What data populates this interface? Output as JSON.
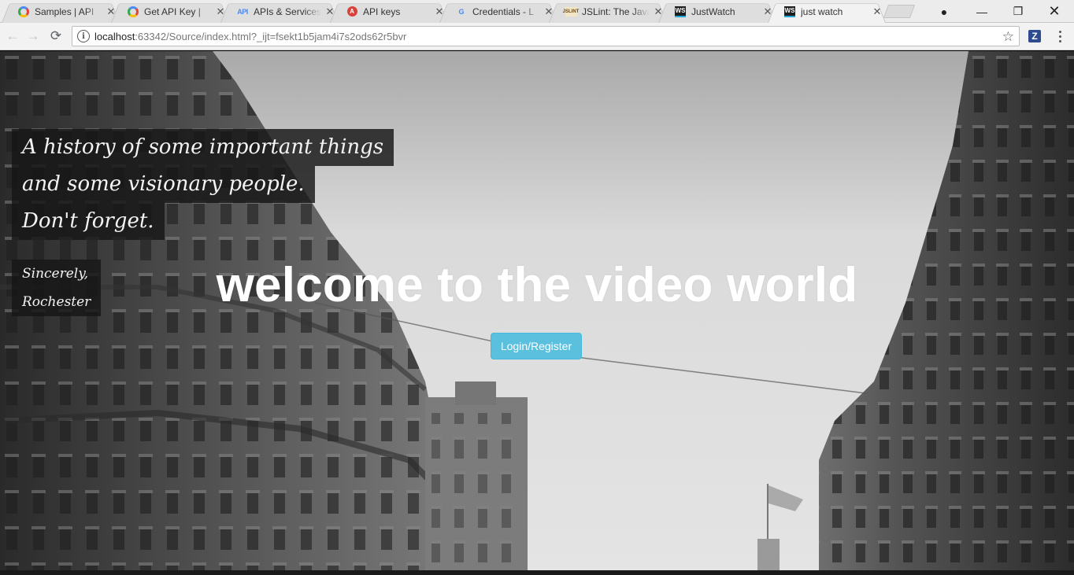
{
  "browser": {
    "tabs": [
      {
        "title": "Samples | API",
        "favicon": "google-dots-icon",
        "active": false
      },
      {
        "title": "Get API Key |",
        "favicon": "google-dots-icon",
        "active": false
      },
      {
        "title": "APIs & Services",
        "favicon": "api-icon",
        "active": false
      },
      {
        "title": "API keys",
        "favicon": "api-keys-icon",
        "active": false
      },
      {
        "title": "Credentials - L",
        "favicon": "google-g-icon",
        "active": false
      },
      {
        "title": "JSLint: The Java",
        "favicon": "jslint-icon",
        "active": false
      },
      {
        "title": "JustWatch",
        "favicon": "webstorm-icon",
        "active": false
      },
      {
        "title": "just watch",
        "favicon": "webstorm-icon",
        "active": true
      }
    ],
    "favicon_text": {
      "api": "API",
      "api_keys": "A",
      "google_g": "G",
      "jslint": "JSLINT",
      "ws": "WS"
    },
    "tab_close": "✕",
    "window_controls": {
      "profile": "●",
      "minimize": "—",
      "restore": "❐",
      "close": "✕"
    },
    "nav": {
      "back": "←",
      "forward": "→",
      "reload": "⟳"
    },
    "address": {
      "info": "i",
      "host": "localhost",
      "rest": ":63342/Source/index.html?_ijt=fsekt1b5jam4i7s2ods62r5bvr"
    },
    "star": "☆",
    "extension": "Z"
  },
  "page": {
    "quote_lines": [
      "A history of some important things",
      "and some visionary people.",
      "Don't forget."
    ],
    "signature_lines": [
      "Sincerely,",
      "Rochester"
    ],
    "heading": "welcome to the video world",
    "login_button": "Login/Register"
  }
}
